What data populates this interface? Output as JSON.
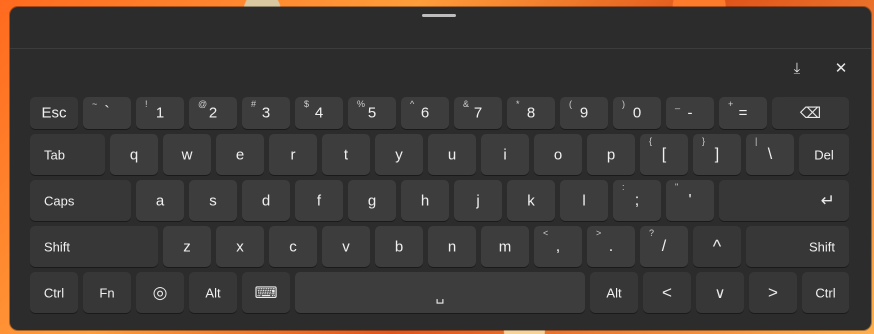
{
  "window": {
    "restore_icon": "dock-icon",
    "close_icon": "close-icon",
    "restore_glyph": "⤓",
    "close_glyph": "✕"
  },
  "row1": [
    {
      "main": "Esc"
    },
    {
      "main": "`",
      "sec": "~"
    },
    {
      "main": "1",
      "sec": "!"
    },
    {
      "main": "2",
      "sec": "@"
    },
    {
      "main": "3",
      "sec": "#"
    },
    {
      "main": "4",
      "sec": "$"
    },
    {
      "main": "5",
      "sec": "%"
    },
    {
      "main": "6",
      "sec": "^"
    },
    {
      "main": "7",
      "sec": "&"
    },
    {
      "main": "8",
      "sec": "*"
    },
    {
      "main": "9",
      "sec": "("
    },
    {
      "main": "0",
      "sec": ")"
    },
    {
      "main": "-",
      "sec": "_"
    },
    {
      "main": "=",
      "sec": "+"
    },
    {
      "main": "⌫"
    }
  ],
  "row2": [
    {
      "main": "Tab"
    },
    {
      "main": "q"
    },
    {
      "main": "w"
    },
    {
      "main": "e"
    },
    {
      "main": "r"
    },
    {
      "main": "t"
    },
    {
      "main": "y"
    },
    {
      "main": "u"
    },
    {
      "main": "i"
    },
    {
      "main": "o"
    },
    {
      "main": "p"
    },
    {
      "main": "[",
      "sec": "{"
    },
    {
      "main": "]",
      "sec": "}"
    },
    {
      "main": "\\",
      "sec": "|"
    },
    {
      "main": "Del"
    }
  ],
  "row3": [
    {
      "main": "Caps"
    },
    {
      "main": "a"
    },
    {
      "main": "s"
    },
    {
      "main": "d"
    },
    {
      "main": "f"
    },
    {
      "main": "g"
    },
    {
      "main": "h"
    },
    {
      "main": "j"
    },
    {
      "main": "k"
    },
    {
      "main": "l"
    },
    {
      "main": ";",
      "sec": ":"
    },
    {
      "main": "'",
      "sec": "\""
    },
    {
      "main": "↵"
    }
  ],
  "row4": [
    {
      "main": "Shift"
    },
    {
      "main": "z"
    },
    {
      "main": "x"
    },
    {
      "main": "c"
    },
    {
      "main": "v"
    },
    {
      "main": "b"
    },
    {
      "main": "n"
    },
    {
      "main": "m"
    },
    {
      "main": ",",
      "sec": "<"
    },
    {
      "main": ".",
      "sec": ">"
    },
    {
      "main": "/",
      "sec": "?"
    },
    {
      "main": "^"
    },
    {
      "main": "Shift"
    }
  ],
  "row5": [
    {
      "main": "Ctrl"
    },
    {
      "main": "Fn"
    },
    {
      "main": "◎"
    },
    {
      "main": "Alt"
    },
    {
      "main": "⌨"
    },
    {
      "main": "␣"
    },
    {
      "main": "Alt"
    },
    {
      "main": "<"
    },
    {
      "main": "∨"
    },
    {
      "main": ">"
    },
    {
      "main": "Ctrl"
    }
  ]
}
